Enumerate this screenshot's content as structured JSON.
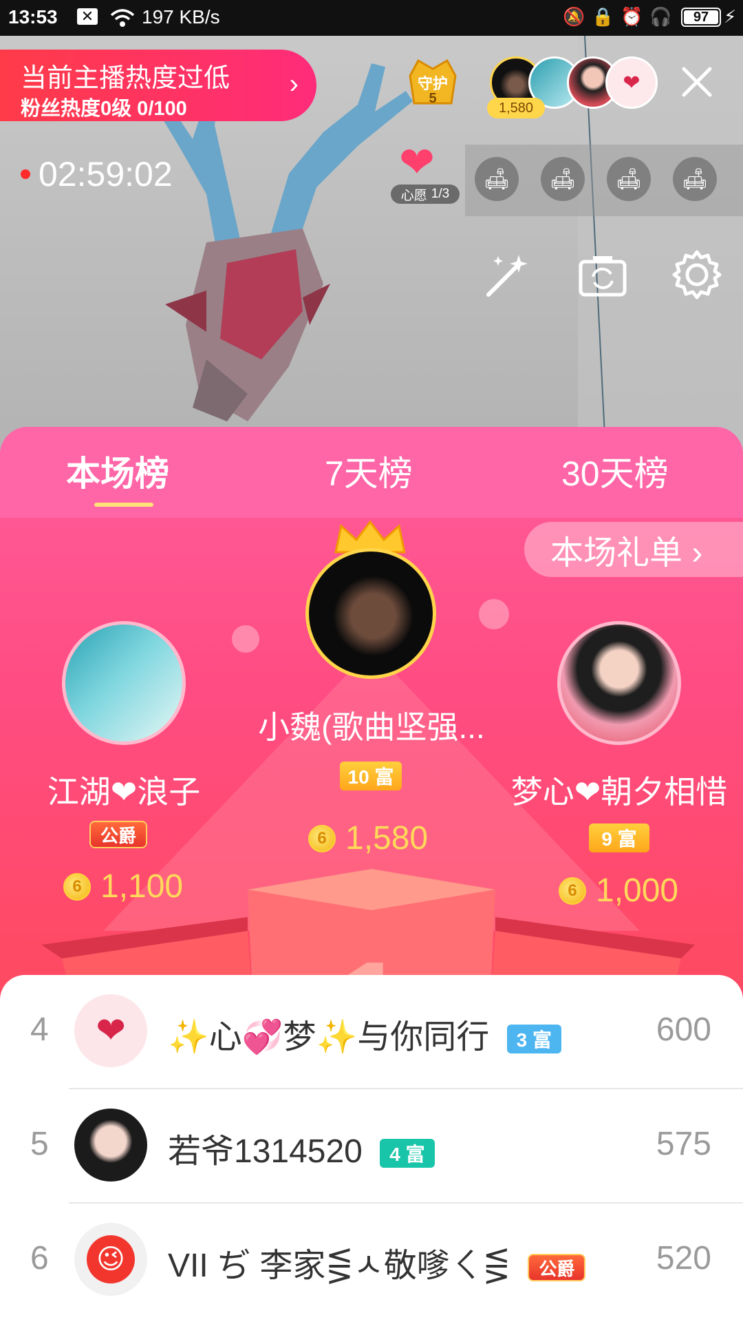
{
  "status_bar": {
    "time": "13:53",
    "network_speed": "197 KB/s",
    "battery": "97"
  },
  "stream": {
    "heat_banner": {
      "title": "当前主播热度过低",
      "subtitle": "粉丝热度0级 0/100"
    },
    "guard_badge": {
      "label": "守护",
      "count": "5"
    },
    "top_viewer_score": "1,580",
    "timer": "02:59:02",
    "wish": {
      "label_prefix": "心愿",
      "progress": "1/3"
    },
    "seat_count": 4
  },
  "leaderboard": {
    "tabs": [
      {
        "label": "本场榜",
        "active": true
      },
      {
        "label": "7天榜",
        "active": false
      },
      {
        "label": "30天榜",
        "active": false
      }
    ],
    "gift_list_button": "本场礼单 ›",
    "podium": {
      "first": {
        "name": "小魏(歌曲坚强...",
        "level": "10 富",
        "score": "1,580"
      },
      "second": {
        "name": "江湖❤浪子",
        "badge": "公爵",
        "score": "1,100"
      },
      "third": {
        "name": "梦心❤朝夕相惜",
        "level": "9 富",
        "score": "1,000"
      }
    },
    "list": [
      {
        "rank": "4",
        "name": "✨心💞梦✨与你同行",
        "rich": "3 富",
        "rich_color": "#4db5f0",
        "score": "600"
      },
      {
        "rank": "5",
        "name": "若爷1314520",
        "rich": "4 富",
        "rich_color": "#19c5a9",
        "score": "575"
      },
      {
        "rank": "6",
        "name": "VII ぢ 李家⋚ㅅ敬嗲ㄑ⋚",
        "noble": "公爵",
        "score": "520"
      }
    ]
  },
  "colors": {
    "accent": "#ff4c82",
    "gold": "#ffd95a",
    "tab_bg": "#ff66a8"
  }
}
